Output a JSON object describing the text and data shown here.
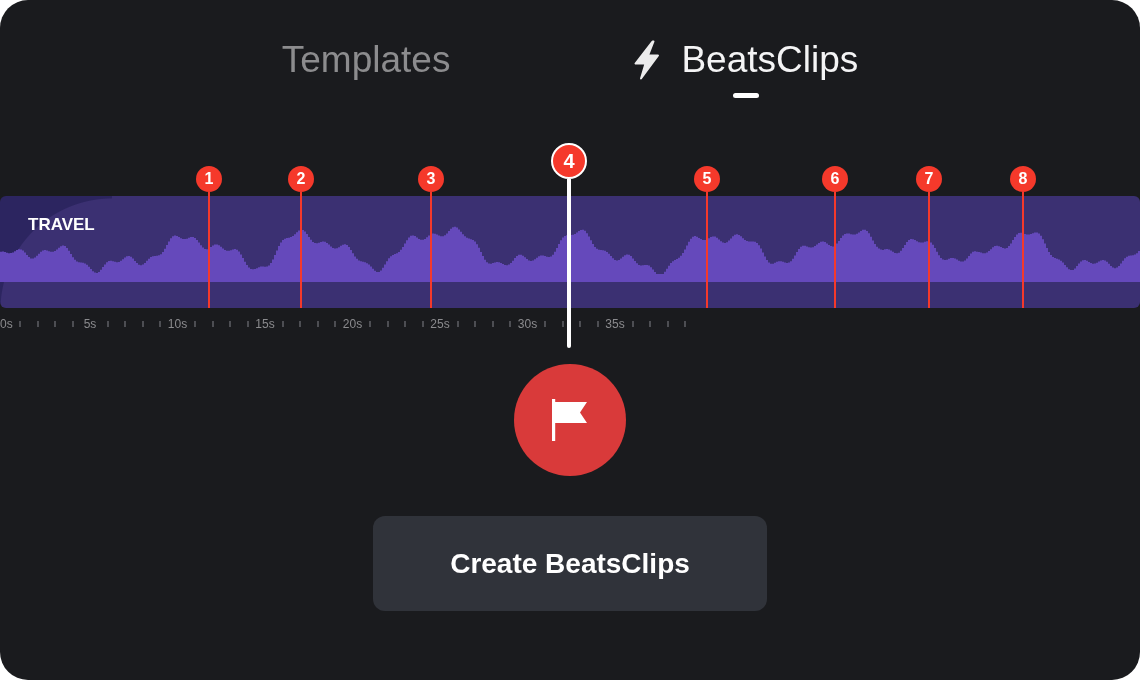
{
  "tabs": [
    {
      "label": "Templates",
      "selected": false,
      "has_icon": false
    },
    {
      "label": "BeatsClips",
      "selected": true,
      "has_icon": true
    }
  ],
  "timeline": {
    "title": "TRAVEL",
    "markers": [
      {
        "label": "1",
        "selected": false
      },
      {
        "label": "2",
        "selected": false
      },
      {
        "label": "3",
        "selected": false
      },
      {
        "label": "4",
        "selected": true
      },
      {
        "label": "5",
        "selected": false
      },
      {
        "label": "6",
        "selected": false
      },
      {
        "label": "7",
        "selected": false
      },
      {
        "label": "8",
        "selected": false
      }
    ],
    "ruler": [
      "0s",
      "5s",
      "10s",
      "15s",
      "20s",
      "25s",
      "30s",
      "35s"
    ]
  },
  "create_button": {
    "label": "Create BeatsClips"
  }
}
